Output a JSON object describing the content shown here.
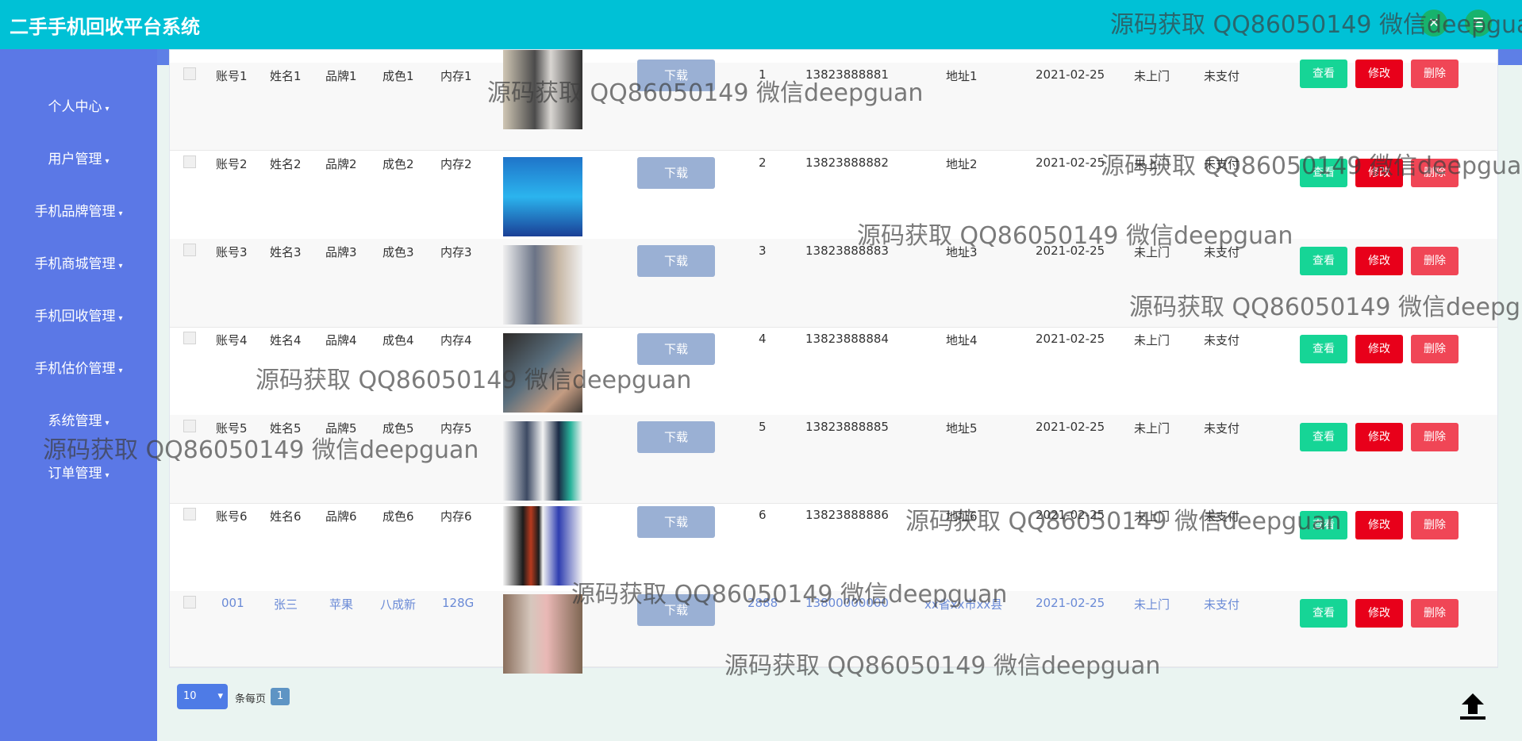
{
  "app": {
    "title": "二手手机回收平台系统"
  },
  "header": {
    "circle1": "✕",
    "circle2": "☰"
  },
  "sidebar": {
    "items": [
      {
        "label": "个人中心"
      },
      {
        "label": "用户管理"
      },
      {
        "label": "手机品牌管理"
      },
      {
        "label": "手机商城管理"
      },
      {
        "label": "手机回收管理"
      },
      {
        "label": "手机估价管理"
      },
      {
        "label": "系统管理"
      },
      {
        "label": "订单管理"
      }
    ]
  },
  "rows": [
    {
      "account": "账号1",
      "name": "姓名1",
      "brand": "品牌1",
      "condition": "成色1",
      "memory": "内存1",
      "download": "下载",
      "quantity": "1",
      "phone": "13823888881",
      "address": "地址1",
      "date": "2021-02-25",
      "visit": "未上门",
      "pay": "未支付",
      "view": "查看",
      "edit": "修改",
      "del": "删除"
    },
    {
      "account": "账号2",
      "name": "姓名2",
      "brand": "品牌2",
      "condition": "成色2",
      "memory": "内存2",
      "download": "下载",
      "quantity": "2",
      "phone": "13823888882",
      "address": "地址2",
      "date": "2021-02-25",
      "visit": "未上门",
      "pay": "未支付",
      "view": "查看",
      "edit": "修改",
      "del": "删除"
    },
    {
      "account": "账号3",
      "name": "姓名3",
      "brand": "品牌3",
      "condition": "成色3",
      "memory": "内存3",
      "download": "下载",
      "quantity": "3",
      "phone": "13823888883",
      "address": "地址3",
      "date": "2021-02-25",
      "visit": "未上门",
      "pay": "未支付",
      "view": "查看",
      "edit": "修改",
      "del": "删除"
    },
    {
      "account": "账号4",
      "name": "姓名4",
      "brand": "品牌4",
      "condition": "成色4",
      "memory": "内存4",
      "download": "下载",
      "quantity": "4",
      "phone": "13823888884",
      "address": "地址4",
      "date": "2021-02-25",
      "visit": "未上门",
      "pay": "未支付",
      "view": "查看",
      "edit": "修改",
      "del": "删除"
    },
    {
      "account": "账号5",
      "name": "姓名5",
      "brand": "品牌5",
      "condition": "成色5",
      "memory": "内存5",
      "download": "下载",
      "quantity": "5",
      "phone": "13823888885",
      "address": "地址5",
      "date": "2021-02-25",
      "visit": "未上门",
      "pay": "未支付",
      "view": "查看",
      "edit": "修改",
      "del": "删除"
    },
    {
      "account": "账号6",
      "name": "姓名6",
      "brand": "品牌6",
      "condition": "成色6",
      "memory": "内存6",
      "download": "下载",
      "quantity": "6",
      "phone": "13823888886",
      "address": "地址6",
      "date": "2021-02-25",
      "visit": "未上门",
      "pay": "未支付",
      "view": "查看",
      "edit": "修改",
      "del": "删除"
    },
    {
      "account": "001",
      "name": "张三",
      "brand": "苹果",
      "condition": "八成新",
      "memory": "128G",
      "download": "下载",
      "quantity": "2888",
      "phone": "13800000000",
      "address": "xx省xx市xx县",
      "date": "2021-02-25",
      "visit": "未上门",
      "pay": "未支付",
      "view": "查看",
      "edit": "修改",
      "del": "删除"
    }
  ],
  "pagination": {
    "page_size": "10",
    "per_page_label": "条每页",
    "current_page": "1"
  },
  "watermark": "源码获取 QQ86050149 微信deepguan",
  "colors": {
    "header": "#00c1d6",
    "sidebar": "#5b78e6",
    "view": "#16d596",
    "edit": "#e8001a",
    "delete": "#f04656"
  }
}
